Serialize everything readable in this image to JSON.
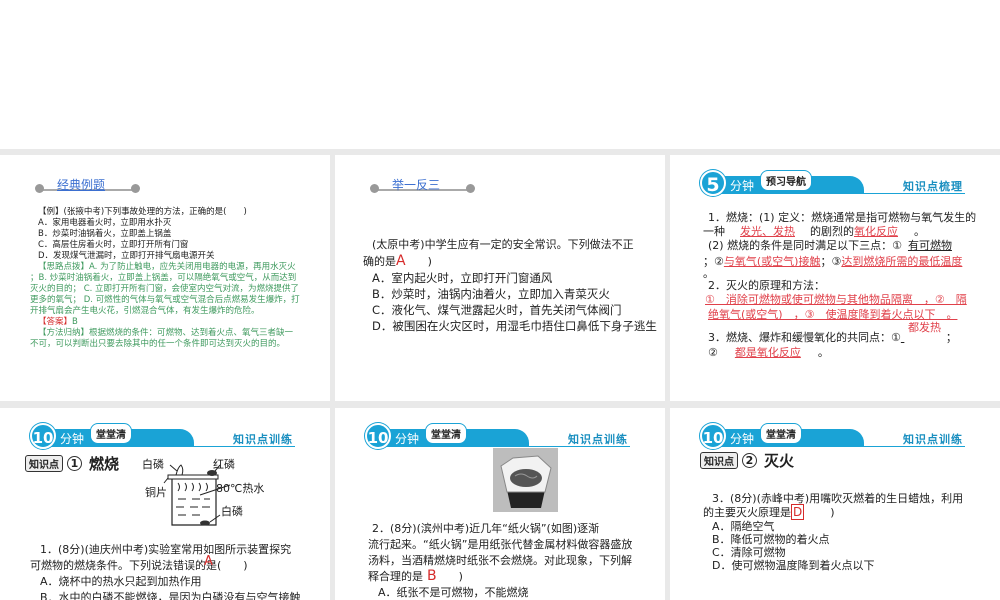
{
  "panel1": {
    "section": "经典例题",
    "lines": [
      "【例】(张掖中考)下列事故处理的方法，正确的是(　　)",
      "A．家用电器着火时，立即用水扑灭",
      "B．炒菜时油锅着火，立即盖上锅盖",
      "C．高层住房着火时，立即打开所有门窗",
      "D．发现煤气泄漏时，立即打开排气扇电源开关"
    ],
    "hint_label": "【思路点拨】",
    "hint": [
      "A. 为了防止触电，应先关闭用电器的电源，再用水灭火",
      "；B. 炒菜时油锅着火，立即盖上锅盖，可以隔绝氧气或空气，从而达到",
      "灭火的目的； C. 立即打开所有门窗，会使室内空气对流，为燃烧提供了",
      "更多的氧气； D. 可燃性的气体与氧气或空气混合后点燃易发生爆炸，打",
      "开排气扇会产生电火花，引燃混合气体，有发生爆炸的危险。"
    ],
    "answer_label": "【答案】",
    "answer": "B",
    "method_label": "【方法归纳】",
    "method": [
      "根据燃烧的条件：可燃物、达到着火点、氧气三者缺一",
      "不可，可以判断出只要去除其中的任一个条件即可达到灭火的目的。"
    ]
  },
  "panel2": {
    "section": "举一反三",
    "q1": "(太原中考)中学生应有一定的安全常识。下列做法不正",
    "q2": "确的是",
    "ans": "A",
    "close": ")",
    "options": [
      "A．室内起火时，立即打开门窗通风",
      "B．炒菜时，油锅内油着火，立即加入青菜灭火",
      "C．液化气、煤气泄露起火时，首先关闭气体阀门",
      "D．被围困在火灾区时，用湿毛巾捂住口鼻低下身子逃生"
    ]
  },
  "panel3": {
    "num": "5",
    "minutes": "分钟",
    "tag": "预习导航",
    "right": "知识点梳理",
    "l1": "1．燃烧：(1) 定义：燃烧通常是指可燃物与氧气发生的",
    "l2a": "一种",
    "l2b": "的剧烈的",
    "l2c": "。",
    "a1": "发光、发热",
    "a2": "氧化反应",
    "l3": "(2) 燃烧的条件是同时满足以下三点：①",
    "a3": "有可燃物",
    "l4a": "；②",
    "l4b": "；③",
    "a4": "与氧气(或空气)接触",
    "a5": "达到燃烧所需的最低温度",
    "l5": "。",
    "l6": "2．灭火的原理和方法：",
    "a6": "①＿消除可燃物或使可燃物与其他物品隔离＿，②＿隔",
    "a7": "绝氧气(或空气)＿，③＿使温度降到着火点以下＿。",
    "l8": "3．燃烧、爆炸和缓慢氧化的共同点：①",
    "l8b": "；",
    "l9": "②",
    "l9b": "。",
    "a8": "都发热",
    "a9": "都是氧化反应"
  },
  "banner10": {
    "num": "10",
    "minutes": "分钟",
    "tag": "堂堂清",
    "right": "知识点训练"
  },
  "panel4": {
    "kp_box": "知识点",
    "kp_num": "1",
    "kp_title": "燃烧",
    "diagram": {
      "white_p_top": "白磷",
      "red_p": "红磷",
      "copper": "铜片",
      "hot_water": "80℃热水",
      "white_p_bottom": "白磷"
    },
    "lines": [
      "1．(8分)(迪庆州中考)实验室常用如图所示装置探究",
      "可燃物的燃烧条件。下列说法错误的是(　　)",
      "A．烧杯中的热水只起到加热作用",
      "B．水中的白磷不能燃烧，是因为白磷没有与空气接触"
    ],
    "ans": "A"
  },
  "panel5": {
    "lines": [
      "2．(8分)(滨州中考)近几年“纸火锅”(如图)逐渐",
      "流行起来。“纸火锅”是用纸张代替金属材料做容器盛放",
      "汤料，当酒精燃烧时纸张不会燃烧。对此现象，下列解",
      "释合理的是",
      "A．纸张不是可燃物，不能燃烧"
    ],
    "ans": "B",
    "close": ")"
  },
  "panel6": {
    "kp_box": "知识点",
    "kp_num": "2",
    "kp_title": "灭火",
    "lines": [
      "3．(8分)(赤峰中考)用嘴吹灭燃着的生日蜡烛，利用",
      "的主要灭火原理是"
    ],
    "ans": "D",
    "close": ")",
    "options": [
      "A．隔绝空气",
      "B．降低可燃物的着火点",
      "C．清除可燃物",
      "D．使可燃物温度降到着火点以下"
    ]
  }
}
